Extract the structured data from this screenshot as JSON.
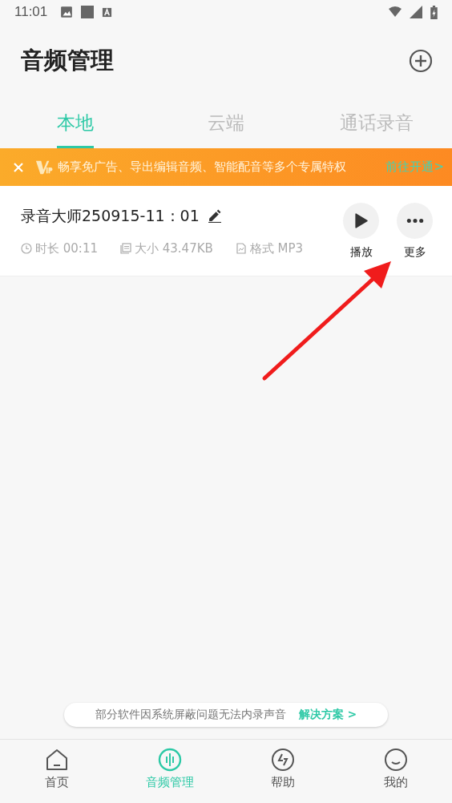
{
  "status_bar": {
    "time": "11:01"
  },
  "header": {
    "title": "音频管理"
  },
  "tabs": [
    {
      "label": "本地",
      "selected": true
    },
    {
      "label": "云端",
      "selected": false
    },
    {
      "label": "通话录音",
      "selected": false
    }
  ],
  "vip_banner": {
    "text": "畅享免广告、导出编辑音频、智能配音等多个专属特权",
    "link": "前往开通>"
  },
  "recordings": [
    {
      "name": "录音大师250915-11：01",
      "duration": "时长 00:11",
      "size": "大小 43.47KB",
      "format": "格式 MP3",
      "actions": [
        {
          "kind": "play",
          "label": "播放"
        },
        {
          "kind": "more",
          "label": "更多"
        }
      ]
    }
  ],
  "tip": {
    "text": "部分软件因系统屏蔽问题无法内录声音",
    "link": "解决方案 >"
  },
  "bottom_nav": [
    {
      "kind": "home",
      "label": "首页",
      "selected": false
    },
    {
      "kind": "audio",
      "label": "音频管理",
      "selected": true
    },
    {
      "kind": "help",
      "label": "帮助",
      "selected": false
    },
    {
      "kind": "me",
      "label": "我的",
      "selected": false
    }
  ]
}
